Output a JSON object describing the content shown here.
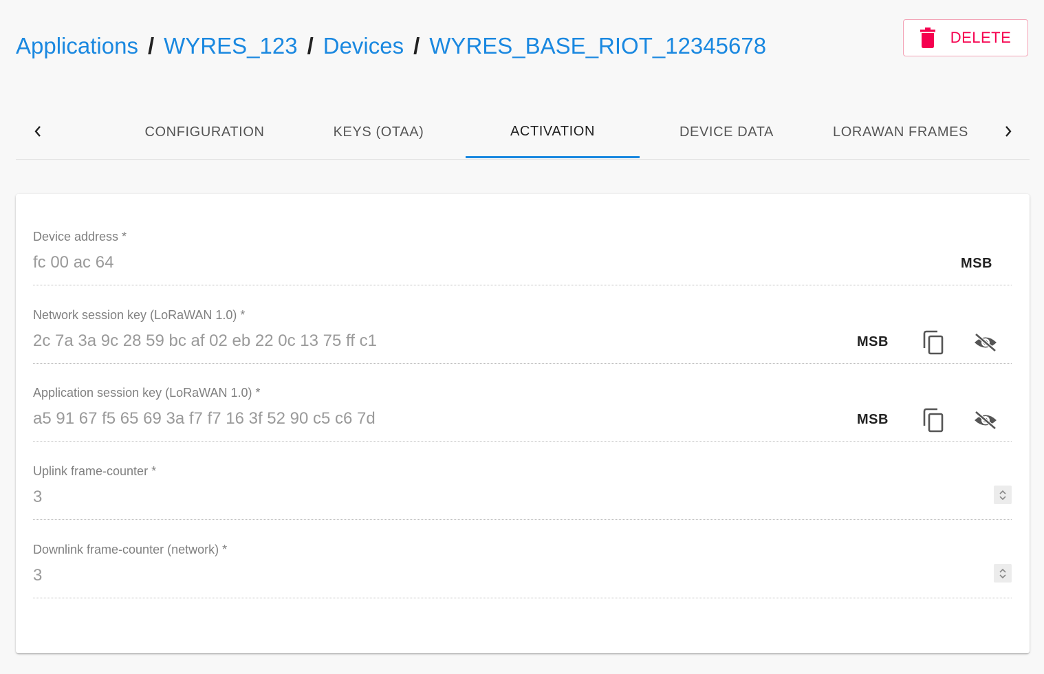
{
  "breadcrumb": {
    "items": [
      "Applications",
      "WYRES_123",
      "Devices",
      "WYRES_BASE_RIOT_12345678"
    ],
    "separator": "/"
  },
  "actions": {
    "delete_label": "DELETE",
    "delete_icon": "trash-icon"
  },
  "tabs": {
    "items": [
      "CONFIGURATION",
      "KEYS (OTAA)",
      "ACTIVATION",
      "DEVICE DATA",
      "LORAWAN FRAMES"
    ],
    "active": "ACTIVATION"
  },
  "form": {
    "device_address": {
      "label": "Device address *",
      "value": "fc 00 ac 64",
      "byte_order": "MSB"
    },
    "nwk_session_key": {
      "label": "Network session key (LoRaWAN 1.0) *",
      "value": "2c 7a 3a 9c 28 59 bc af 02 eb 22 0c 13 75 ff c1",
      "byte_order": "MSB"
    },
    "app_session_key": {
      "label": "Application session key (LoRaWAN 1.0) *",
      "value": "a5 91 67 f5 65 69 3a f7 f7 16 3f 52 90 c5 c6 7d",
      "byte_order": "MSB"
    },
    "uplink_fcnt": {
      "label": "Uplink frame-counter *",
      "value": "3"
    },
    "downlink_fcnt": {
      "label": "Downlink frame-counter (network) *",
      "value": "3"
    }
  },
  "colors": {
    "accent": "#1a88e0",
    "danger": "#f5004f",
    "background": "#f8f8f8"
  }
}
